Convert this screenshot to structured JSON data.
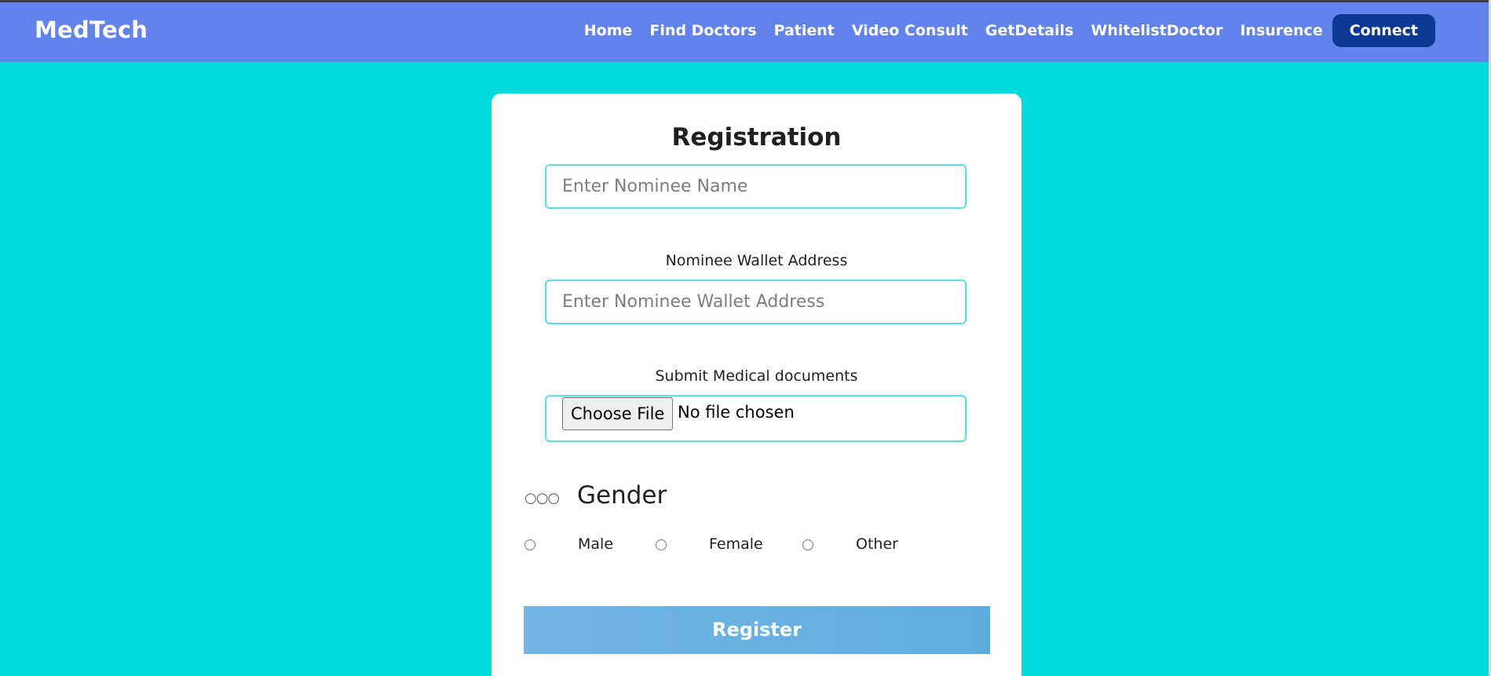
{
  "brand": "MedTech",
  "nav": {
    "links": [
      "Home",
      "Find Doctors",
      "Patient",
      "Video Consult",
      "GetDetails",
      "WhitelistDoctor",
      "Insurence"
    ],
    "connect_label": "Connect"
  },
  "form": {
    "title": "Registration",
    "nominee_name_placeholder": "Enter Nominee Name",
    "wallet_label": "Nominee Wallet Address",
    "wallet_placeholder": "Enter Nominee Wallet Address",
    "docs_label": "Submit Medical documents",
    "file_button_label": "Choose File",
    "file_status": "No file chosen",
    "gender_glyphs": "○○○",
    "gender_title": "Gender",
    "gender_options": [
      "Male",
      "Female",
      "Other"
    ],
    "register_label": "Register"
  },
  "colors": {
    "background": "#00dcde",
    "navbar": "#6282ec",
    "connect_button": "#0e3993",
    "register_button": "#6bb3e2",
    "field_border": "#57e0e3"
  }
}
